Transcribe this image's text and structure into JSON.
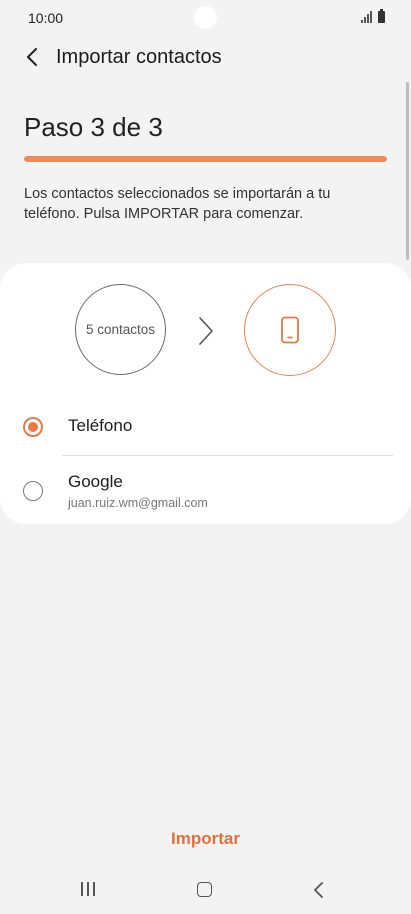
{
  "status_bar": {
    "time": "10:00"
  },
  "app_bar": {
    "title": "Importar contactos"
  },
  "step": {
    "title": "Paso 3 de 3",
    "progress": 1.0
  },
  "description": "Los contactos seleccionados se importarán a tu teléfono. Pulsa IMPORTAR para comenzar.",
  "transfer": {
    "source_label": "5 contactos",
    "arrow_icon": "chevron-right-icon",
    "target_icon": "phone-icon"
  },
  "options": [
    {
      "label": "Teléfono",
      "sublabel": "",
      "selected": true
    },
    {
      "label": "Google",
      "sublabel": "juan.ruiz.wm@gmail.com",
      "selected": false
    }
  ],
  "actions": {
    "import_label": "Importar"
  },
  "colors": {
    "accent": "#e67a46",
    "progress": "#ef8a5b",
    "background": "#f3f3f3",
    "card": "#ffffff"
  },
  "nav_bar": {
    "icons": [
      "recents-icon",
      "home-icon",
      "back-icon"
    ]
  }
}
